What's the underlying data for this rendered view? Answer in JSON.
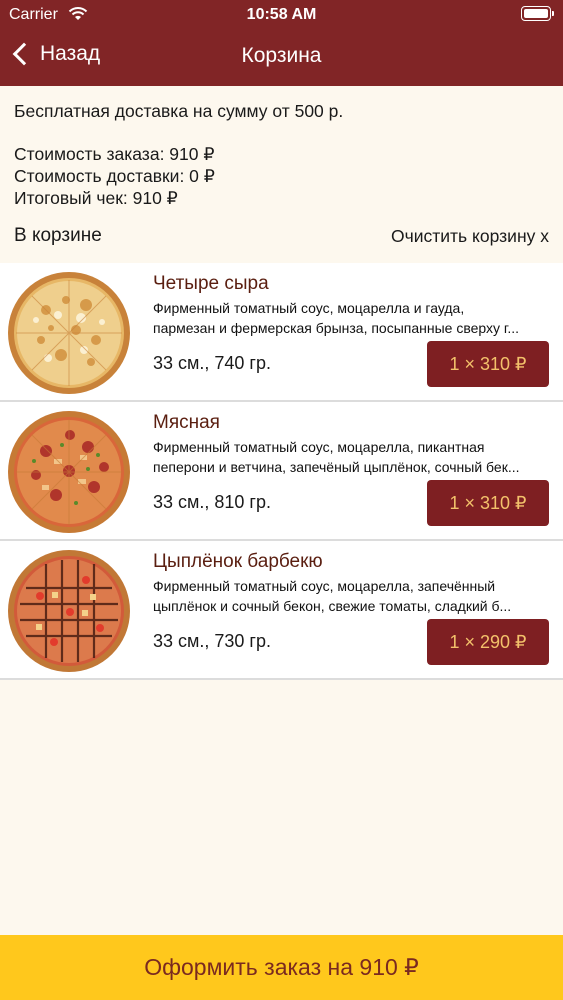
{
  "status": {
    "carrier": "Carrier",
    "time": "10:58 AM"
  },
  "nav": {
    "back_label": "Назад",
    "title": "Корзина"
  },
  "summary": {
    "free_delivery": "Бесплатная доставка на сумму от 500 р.",
    "order_cost": "Стоимость заказа: 910 ₽",
    "delivery_cost": "Стоимость доставки: 0 ₽",
    "total": "Итоговый чек: 910 ₽"
  },
  "cart": {
    "title": "В корзине",
    "clear_label": "Очистить корзину х",
    "items": [
      {
        "name": "Четыре сыра",
        "desc_line1": "Фирменный томатный соус, моцарелла и гауда,",
        "desc_line2": "пармезан и фермерская брынза, посыпанные сверху г...",
        "size": "33 см., 740 гр.",
        "qty_price": "1 × 310 ₽",
        "image": "pizza-four-cheese"
      },
      {
        "name": "Мясная",
        "desc_line1": "Фирменный томатный соус, моцарелла, пикантная",
        "desc_line2": "пеперони и ветчина, запечёный цыплёнок, сочный бек...",
        "size": "33 см., 810 гр.",
        "qty_price": "1 × 310 ₽",
        "image": "pizza-meat"
      },
      {
        "name": "Цыплёнок барбекю",
        "desc_line1": "Фирменный томатный соус, моцарелла, запечённый",
        "desc_line2": "цыплёнок и сочный бекон, свежие томаты, сладкий б...",
        "size": "33 см., 730 гр.",
        "qty_price": "1 × 290 ₽",
        "image": "pizza-bbq-chicken"
      }
    ]
  },
  "checkout": {
    "label": "Оформить заказ на 910 ₽"
  },
  "colors": {
    "header": "#812526",
    "button": "#7e1f22",
    "button_text": "#f3c16b",
    "checkout": "#ffc81c",
    "background": "#fdf8ee"
  }
}
